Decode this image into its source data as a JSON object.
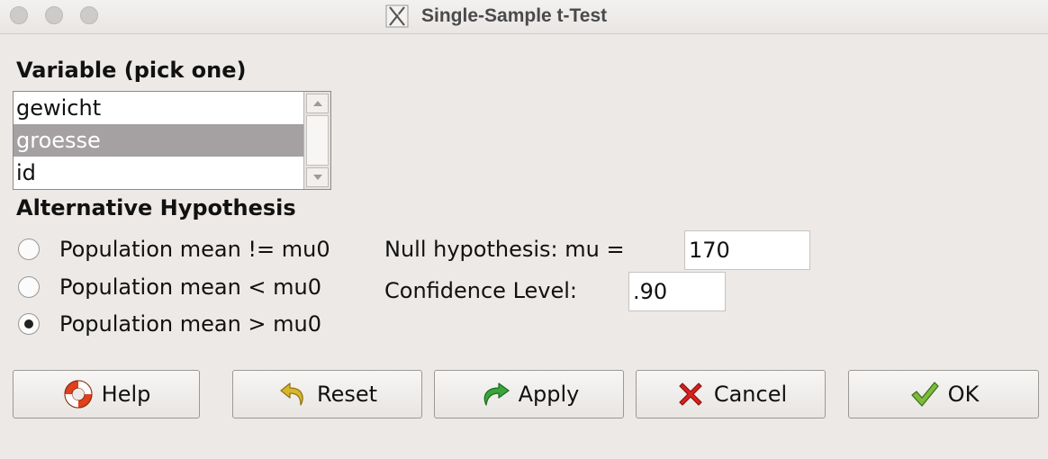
{
  "window": {
    "title": "Single-Sample t-Test"
  },
  "variable": {
    "label": "Variable (pick one)",
    "items": [
      "gewicht",
      "groesse",
      "id"
    ],
    "selected": "groesse"
  },
  "hypothesis": {
    "label": "Alternative Hypothesis",
    "options": [
      "Population mean != mu0",
      "Population mean < mu0",
      "Population mean > mu0"
    ],
    "selected_index": 2
  },
  "null_hypothesis": {
    "label": "Null hypothesis: mu =",
    "value": "170"
  },
  "confidence": {
    "label": "Confidence Level:",
    "value": ".90"
  },
  "buttons": {
    "help": "Help",
    "reset": "Reset",
    "apply": "Apply",
    "cancel": "Cancel",
    "ok": "OK"
  },
  "icons": {
    "help": "lifebuoy-icon",
    "reset": "undo-arrow-icon",
    "apply": "redo-arrow-icon",
    "cancel": "red-x-icon",
    "ok": "green-check-icon"
  },
  "colors": {
    "window_bg": "#ede9e6",
    "selection_bg": "#a5a1a3",
    "help_red": "#e0401c",
    "reset_gold": "#c9a41f",
    "apply_green": "#3aa53a",
    "cancel_red": "#d9211f",
    "ok_green": "#5a9a2a"
  }
}
